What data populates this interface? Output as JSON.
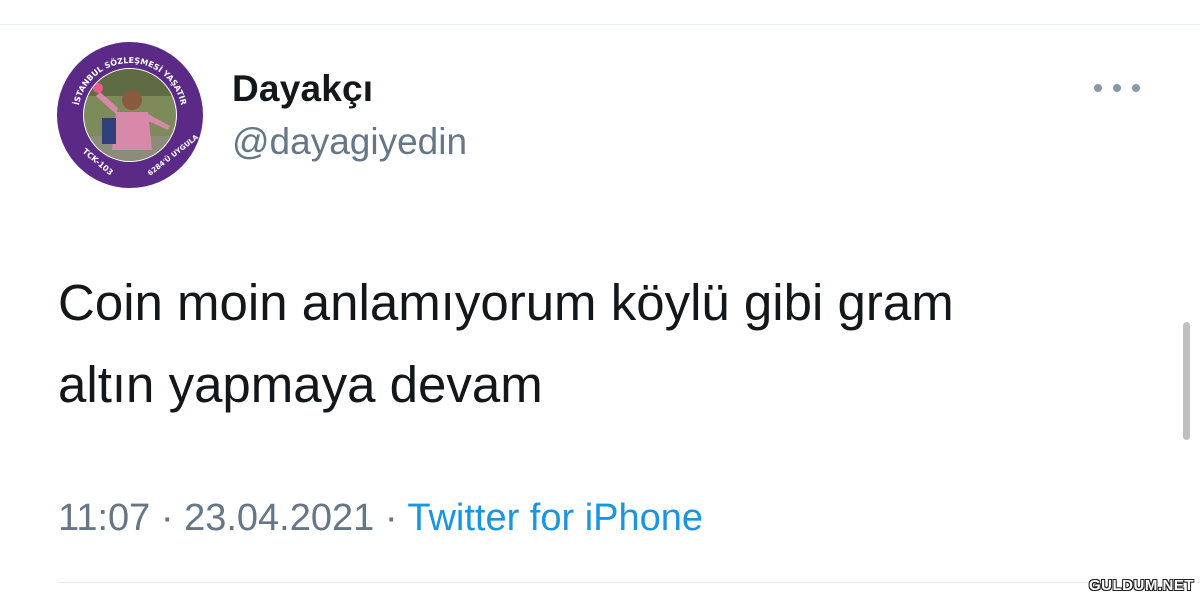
{
  "profile": {
    "display_name": "Dayakçı",
    "handle": "@dayagiyedin",
    "avatar_ring_top_text": "İSTANBUL SÖZLEŞMESİ YAŞATIR",
    "avatar_ring_left_text": "TCK-103",
    "avatar_ring_bottom_text": "6284'Ü UYGULA",
    "avatar_ring_color": "#5b2a86"
  },
  "tweet": {
    "line1": "Coin moin anlamıyorum köylü gibi gram",
    "line2": "altın yapmaya devam",
    "time": "11:07",
    "date": "23.04.2021",
    "separator": "·",
    "source": "Twitter for iPhone"
  },
  "menu": {
    "icon": "more-horizontal-icon"
  },
  "watermark": "GULDUM.NET",
  "colors": {
    "text_primary": "#14171a",
    "text_secondary": "#657786",
    "link": "#1b95e0"
  }
}
